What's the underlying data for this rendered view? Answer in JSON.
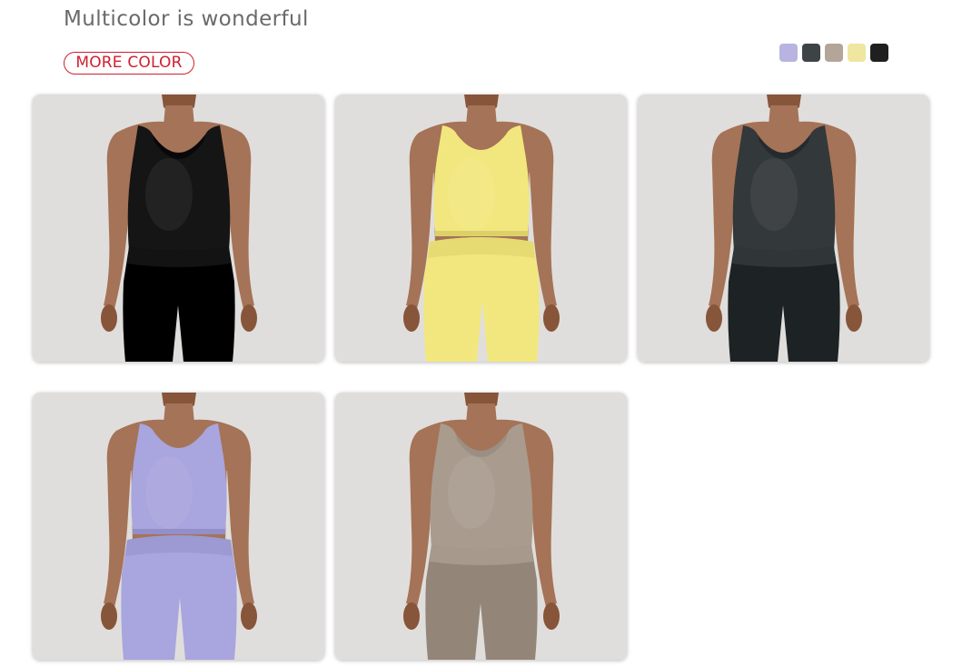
{
  "header": {
    "title": "Multicolor is wonderful",
    "more_color_label": "MORE COLOR"
  },
  "swatches": [
    {
      "name": "lavender",
      "color": "#b7b4e2"
    },
    {
      "name": "charcoal",
      "color": "#3e4446"
    },
    {
      "name": "taupe",
      "color": "#b3a598"
    },
    {
      "name": "butter-yellow",
      "color": "#efe6a0"
    },
    {
      "name": "black",
      "color": "#1f1f1f"
    }
  ],
  "products": [
    {
      "name": "black",
      "garment": "#151515",
      "pose": "back"
    },
    {
      "name": "yellow",
      "garment": "#f2e77e",
      "pose": "crop"
    },
    {
      "name": "charcoal",
      "garment": "#33383a",
      "pose": "back"
    },
    {
      "name": "lavender",
      "garment": "#a9a5de",
      "pose": "crop"
    },
    {
      "name": "taupe",
      "garment": "#a99c8f",
      "pose": "back"
    }
  ],
  "colors": {
    "accent": "#cf1f2e",
    "background_card": "#dcdad8",
    "skin": "#a57357"
  }
}
